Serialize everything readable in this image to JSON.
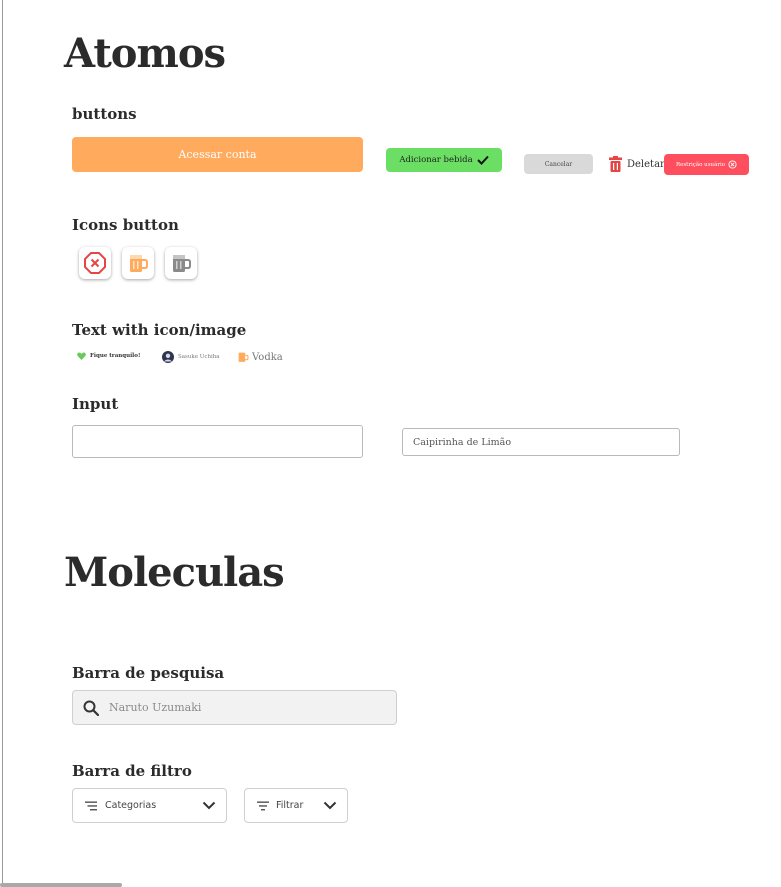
{
  "atomos": {
    "title": "Atomos",
    "buttons_heading": "buttons",
    "buttons": {
      "primary": "Acessar conta",
      "add_drink": "Adicionar bebida",
      "cancel": "Cancelar",
      "delete": "Deletar",
      "restrict": "Restrição usuário"
    },
    "icons_heading": "Icons button",
    "text_icon_heading": "Text with icon/image",
    "text_icons": {
      "calm": "Fique tranquilo!",
      "user": "Sasuke Uchiha",
      "drink": "Vodka"
    },
    "input_heading": "Input",
    "inputs": {
      "empty_value": "",
      "filled_value": "Caipirinha de Limão"
    }
  },
  "moleculas": {
    "title": "Moleculas",
    "search_heading": "Barra de pesquisa",
    "search_placeholder": "Naruto Uzumaki",
    "filter_heading": "Barra de filtro",
    "filter_categories": "Categorias",
    "filter_label": "Filtrar"
  },
  "colors": {
    "primary": "#ffaa5c",
    "success": "#6adf63",
    "neutral": "#d9d9d9",
    "danger": "#ff4f5e",
    "heart": "#6cc75f"
  },
  "icons": [
    "check-icon",
    "trash-icon",
    "x-circle-icon",
    "x-octagon-icon",
    "beer-orange-icon",
    "beer-gray-icon",
    "heart-icon",
    "avatar-icon",
    "beer-small-icon",
    "search-icon",
    "filter-lines-icon",
    "chevron-down-icon"
  ]
}
